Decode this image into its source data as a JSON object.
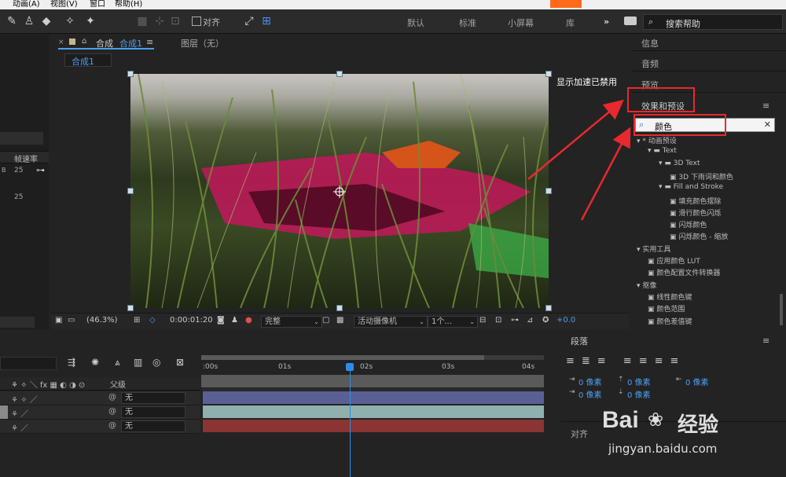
{
  "menu": [
    "动画(A)",
    "视图(V)",
    "窗口",
    "帮助(H)"
  ],
  "toolbar": {
    "snap_label": "对齐",
    "workspaces": [
      "默认",
      "标准",
      "小屏幕",
      "库"
    ],
    "overflow": "»",
    "search_placeholder": "搜索帮助"
  },
  "composition": {
    "tab_prefix": "合成",
    "tab_name": "合成1",
    "layer_tab": "图层（无）",
    "breadcrumb": "合成1",
    "gpu_notice": "显示加速已禁用"
  },
  "left_panel": {
    "fps_header": "帧速率",
    "values": [
      "25",
      "25"
    ],
    "b_label": "B"
  },
  "viewer_bar": {
    "zoom": "(46.3%)",
    "timecode": "0:00:01:20",
    "quality": "完整",
    "camera": "活动摄像机",
    "views": "1个...",
    "exposure": "+0.0"
  },
  "right_panel": {
    "info": "信息",
    "audio": "音频",
    "preview": "预览",
    "effects_title": "效果和预设",
    "search_value": "颜色",
    "tree": [
      {
        "level": 0,
        "type": "cat",
        "label": "* 动画预设"
      },
      {
        "level": 1,
        "type": "folder",
        "label": "Text"
      },
      {
        "level": 2,
        "type": "folder",
        "label": "3D Text"
      },
      {
        "level": 3,
        "type": "fx",
        "label": "3D 下雨词和颜色"
      },
      {
        "level": 2,
        "type": "folder",
        "label": "Fill and Stroke"
      },
      {
        "level": 3,
        "type": "fx",
        "label": "填充颜色摆除"
      },
      {
        "level": 3,
        "type": "fx",
        "label": "滑行颜色闪烁"
      },
      {
        "level": 3,
        "type": "fx",
        "label": "闪烁颜色"
      },
      {
        "level": 3,
        "type": "fx",
        "label": "闪烁颜色 - 缩放"
      },
      {
        "level": 0,
        "type": "cat",
        "label": "实用工具"
      },
      {
        "level": 1,
        "type": "fx",
        "label": "应用颜色 LUT"
      },
      {
        "level": 1,
        "type": "fx",
        "label": "颜色配置文件转换器"
      },
      {
        "level": 0,
        "type": "cat",
        "label": "抠像"
      },
      {
        "level": 1,
        "type": "fx",
        "label": "线性颜色键"
      },
      {
        "level": 1,
        "type": "fx",
        "label": "颜色范围"
      },
      {
        "level": 1,
        "type": "fx",
        "label": "颜色差值键"
      }
    ]
  },
  "timeline": {
    "parent_header": "父级",
    "rows": [
      {
        "parent": "无"
      },
      {
        "parent": "无"
      },
      {
        "parent": "无"
      }
    ],
    "ticks": [
      ":00s",
      "01s",
      "02s",
      "03s",
      "04s"
    ],
    "layer_colors": [
      "#5a6096",
      "#8fb0ad",
      "#8a3434"
    ]
  },
  "paragraph": {
    "title": "段落",
    "unit_value": "0 像素",
    "align_label": "对齐"
  },
  "watermark": {
    "brand": "Bai",
    "brand2": "经验",
    "url": "jingyan.baidu.com"
  }
}
